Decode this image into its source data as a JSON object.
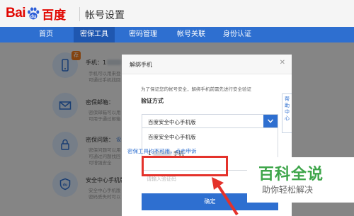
{
  "header": {
    "logo": {
      "left": "Bai",
      "right": "du",
      "chinese": "百度"
    },
    "title": "帐号设置"
  },
  "nav": {
    "items": [
      "首页",
      "密保工具",
      "密码管理",
      "帐号关联",
      "身份认证"
    ],
    "active_index": 1
  },
  "background_list": [
    {
      "title": "手机：1",
      "badge": "荐",
      "desc": [
        "手机可以用来登",
        "可通过手机找回"
      ]
    },
    {
      "title": "密保邮箱：",
      "desc": [
        "密保邮箱可以用",
        "可用于通过邮箱"
      ]
    },
    {
      "title": "密保问题：",
      "link": "设",
      "desc": [
        "密保问题可以用",
        "可通过问题找回",
        "可增强安全"
      ]
    },
    {
      "title": "安全中心手机版",
      "desc": [
        "安全中心手机版",
        "密码丢失时可以"
      ]
    }
  ],
  "dialog": {
    "title": "解绑手机",
    "note": "为了保证您的帐号安全，解绑手机前需先进行安全验证",
    "label": "验证方式",
    "select_value": "百度安全中心手机版",
    "options": [
      {
        "text": "百度安全中心手机版"
      },
      {
        "text": "1",
        "suffix": "手机"
      }
    ],
    "help_link": "密保工具均不可用，点击申诉",
    "placeholder": "请输入验证码",
    "confirm": "确定",
    "side_tab": "帮助中心"
  },
  "watermark": {
    "main": "百科全说",
    "sub": "助你轻松解决"
  },
  "colors": {
    "brand_red": "#e10601",
    "nav_blue": "#2e6fd0",
    "highlight_red": "#e4322b",
    "watermark_green": "#3ea54a"
  }
}
